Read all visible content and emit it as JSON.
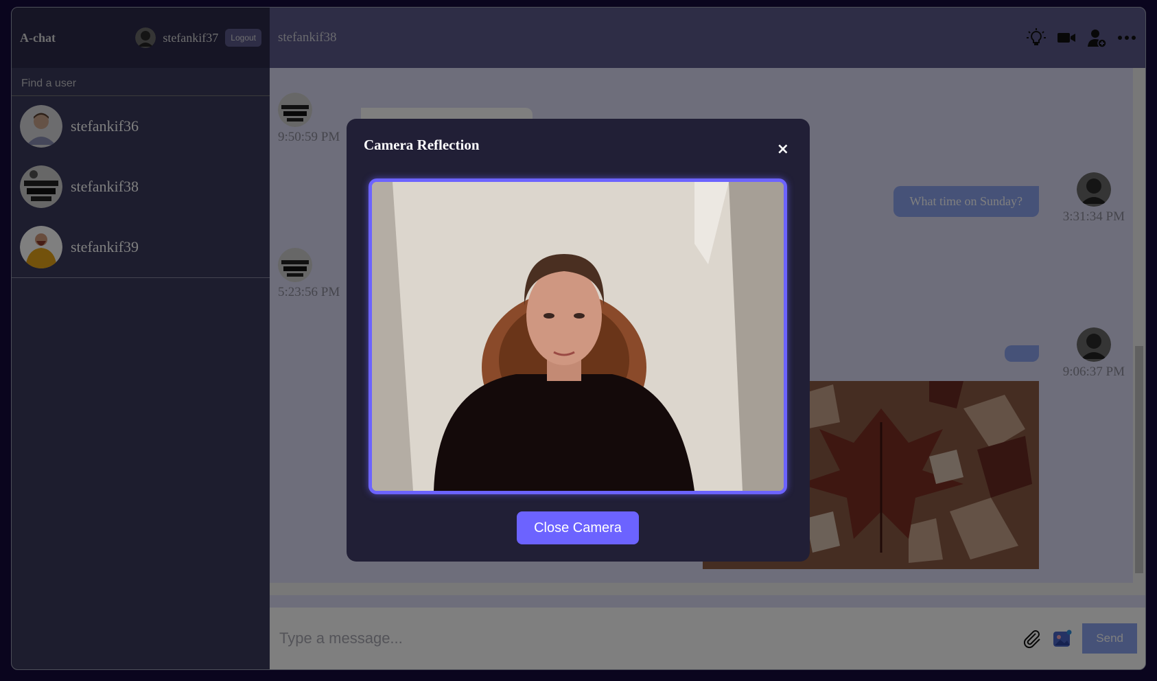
{
  "sidebar": {
    "brand": "A-chat",
    "current_user": "stefankif37",
    "logout_label": "Logout",
    "search_placeholder": "Find a user",
    "chats": [
      {
        "name": "stefankif36"
      },
      {
        "name": "stefankif38"
      },
      {
        "name": "stefankif39"
      }
    ]
  },
  "chat": {
    "title": "stefankif38",
    "messages": [
      {
        "time": "9:50:59 PM"
      },
      {
        "text": "What time on Sunday?",
        "time": "3:31:34 PM"
      },
      {
        "time": "5:23:56 PM"
      },
      {
        "time": "9:06:37 PM"
      }
    ],
    "input_placeholder": "Type a message...",
    "send_label": "Send"
  },
  "modal": {
    "title": "Camera Reflection",
    "close_symbol": "×",
    "button_label": "Close Camera"
  },
  "colors": {
    "accent": "#6c63ff",
    "bubble": "#8da4f1",
    "sidebar": "#3a3a5c",
    "navbar": "#2d2b4a",
    "header": "#5d5b8d"
  }
}
